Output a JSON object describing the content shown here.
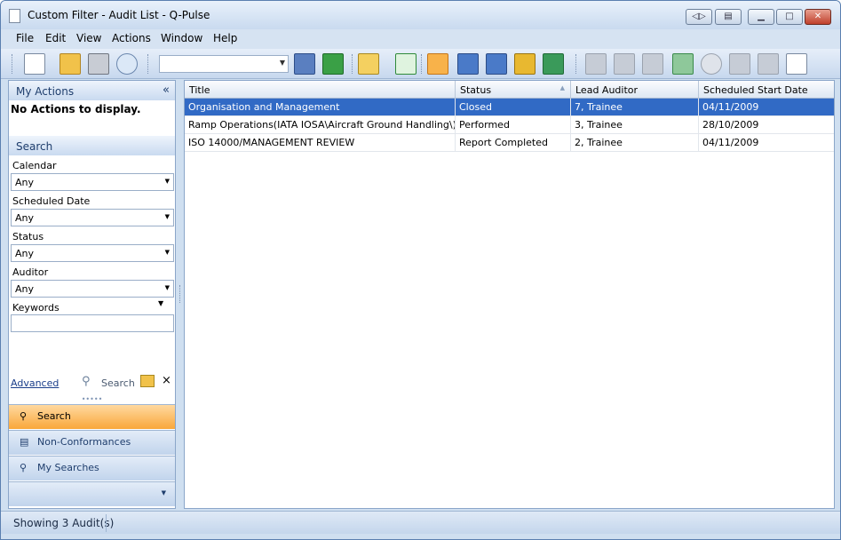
{
  "window": {
    "title": "Custom Filter - Audit List - Q-Pulse"
  },
  "menu": [
    "File",
    "Edit",
    "View",
    "Actions",
    "Window",
    "Help"
  ],
  "my_actions": {
    "header": "My Actions",
    "collapse": "«",
    "empty": "No Actions to display."
  },
  "search_panel": {
    "header": "Search",
    "fields": [
      {
        "label": "Calendar",
        "value": "Any"
      },
      {
        "label": "Scheduled Date",
        "value": "Any"
      },
      {
        "label": "Status",
        "value": "Any"
      },
      {
        "label": "Auditor",
        "value": "Any"
      }
    ],
    "keywords_label": "Keywords",
    "keywords_value": "",
    "advanced": "Advanced",
    "search_btn": "Search",
    "clear": "×"
  },
  "nav": {
    "items": [
      "Search",
      "Non-Conformances",
      "My Searches"
    ]
  },
  "grid": {
    "columns": [
      "Title",
      "Status",
      "Lead Auditor",
      "Scheduled Start Date"
    ],
    "rows": [
      [
        "Organisation and Management",
        "Closed",
        "7, Trainee",
        "04/11/2009"
      ],
      [
        "Ramp Operations(IATA IOSA\\Aircraft Ground Handling\\)",
        "Performed",
        "3, Trainee",
        "28/10/2009"
      ],
      [
        "ISO 14000/MANAGEMENT REVIEW",
        "Report Completed",
        "2, Trainee",
        "04/11/2009"
      ]
    ]
  },
  "status": {
    "text": "Showing 3 Audit(s)"
  },
  "colors": {
    "selection": "#316ac5",
    "nav_active": "#f9a73a"
  }
}
